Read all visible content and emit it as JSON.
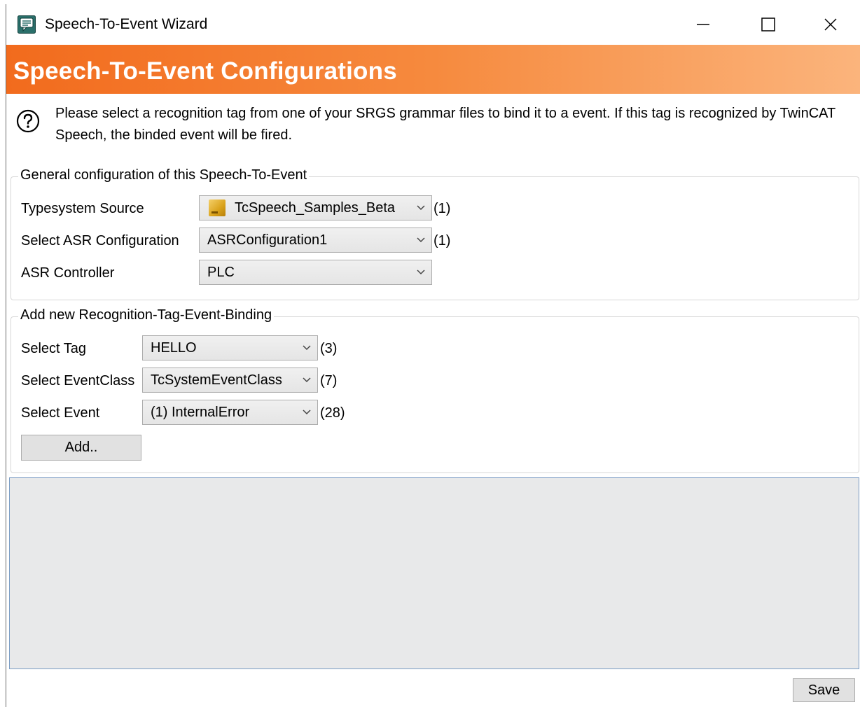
{
  "window": {
    "title": "Speech-To-Event Wizard"
  },
  "banner": {
    "title": "Speech-To-Event Configurations"
  },
  "help": {
    "text": "Please select a recognition tag from one of your SRGS grammar files to bind it to a event. If this tag is recognized by TwinCAT Speech, the binded event will be fired."
  },
  "general": {
    "title": "General configuration of this Speech-To-Event",
    "typesystem_label": "Typesystem Source",
    "typesystem_value": "TcSpeech_Samples_Beta",
    "typesystem_count": "(1)",
    "asr_config_label": "Select ASR Configuration",
    "asr_config_value": "ASRConfiguration1",
    "asr_config_count": "(1)",
    "asr_controller_label": "ASR Controller",
    "asr_controller_value": "PLC"
  },
  "binding": {
    "title": "Add new Recognition-Tag-Event-Binding",
    "tag_label": "Select Tag",
    "tag_value": "HELLO",
    "tag_count": "(3)",
    "eventclass_label": "Select EventClass",
    "eventclass_value": "TcSystemEventClass",
    "eventclass_count": "(7)",
    "event_label": "Select Event",
    "event_value": "(1) InternalError",
    "event_count": "(28)",
    "add_label": "Add.."
  },
  "footer": {
    "save_label": "Save"
  },
  "colors": {
    "banner_start": "#f26b1d",
    "banner_end": "#fbb47c",
    "listbox_bg": "#e8e9ea",
    "listbox_border": "#7a9cc4"
  },
  "icons": {
    "app": "speech-bubble-icon",
    "help": "question-circle-icon",
    "typesystem": "plc-project-icon"
  }
}
